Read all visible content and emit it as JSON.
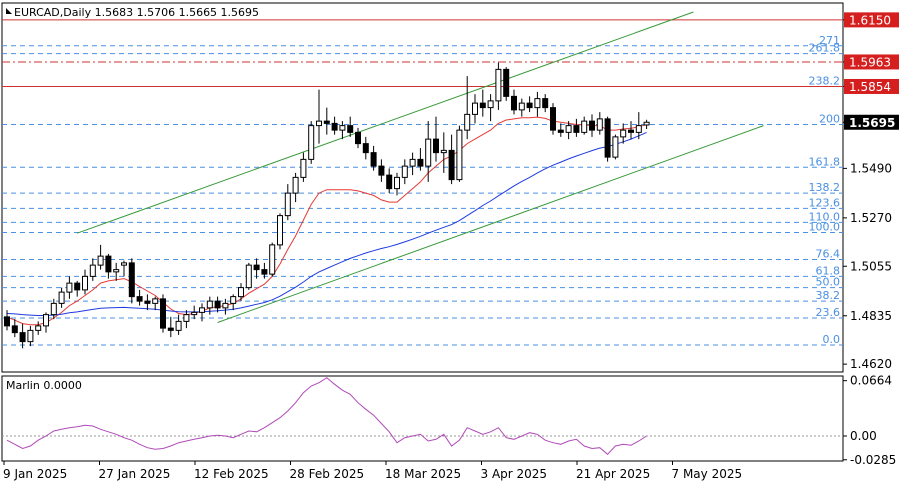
{
  "header": {
    "symbol": "EURCAD,Daily",
    "ohlc": "1.5683 1.5706 1.5665 1.5695"
  },
  "indicator_header": {
    "name": "Marlin",
    "value": "0.0000"
  },
  "colors": {
    "bull_candle": "#ffffff",
    "bear_candle": "#000000",
    "ma_red": "#e53935",
    "ma_blue": "#1e3ae0",
    "channel": "#3a9a3a",
    "fib": "#4a90e2",
    "resistance": "#d03030",
    "marlin": "#b04ab8",
    "price_tag_bg": "#d51f1f",
    "current_tag_bg": "#000000"
  },
  "chart_data": [
    {
      "type": "candlestick",
      "title": "EURCAD,Daily",
      "x_tick_labels": [
        "9 Jan 2025",
        "27 Jan 2025",
        "12 Feb 2025",
        "28 Feb 2025",
        "18 Mar 2025",
        "3 Apr 2025",
        "21 Apr 2025",
        "7 May 2025"
      ],
      "y_tick_labels": [
        "1.6150",
        "1.5963",
        "1.5854",
        "1.5695",
        "1.5490",
        "1.5270",
        "1.5055",
        "1.4835",
        "1.4620"
      ],
      "ylim": [
        1.4585,
        1.6225
      ],
      "candles": [
        {
          "o": 1.483,
          "h": 1.486,
          "l": 1.477,
          "c": 1.479
        },
        {
          "o": 1.479,
          "h": 1.482,
          "l": 1.474,
          "c": 1.476
        },
        {
          "o": 1.476,
          "h": 1.48,
          "l": 1.469,
          "c": 1.472
        },
        {
          "o": 1.472,
          "h": 1.479,
          "l": 1.47,
          "c": 1.477
        },
        {
          "o": 1.477,
          "h": 1.481,
          "l": 1.475,
          "c": 1.479
        },
        {
          "o": 1.479,
          "h": 1.485,
          "l": 1.476,
          "c": 1.484
        },
        {
          "o": 1.484,
          "h": 1.491,
          "l": 1.482,
          "c": 1.489
        },
        {
          "o": 1.489,
          "h": 1.496,
          "l": 1.487,
          "c": 1.494
        },
        {
          "o": 1.494,
          "h": 1.501,
          "l": 1.491,
          "c": 1.498
        },
        {
          "o": 1.498,
          "h": 1.499,
          "l": 1.492,
          "c": 1.495
        },
        {
          "o": 1.495,
          "h": 1.504,
          "l": 1.493,
          "c": 1.501
        },
        {
          "o": 1.501,
          "h": 1.509,
          "l": 1.499,
          "c": 1.506
        },
        {
          "o": 1.506,
          "h": 1.515,
          "l": 1.504,
          "c": 1.51
        },
        {
          "o": 1.51,
          "h": 1.511,
          "l": 1.5,
          "c": 1.503
        },
        {
          "o": 1.503,
          "h": 1.507,
          "l": 1.499,
          "c": 1.504
        },
        {
          "o": 1.506,
          "h": 1.508,
          "l": 1.501,
          "c": 1.507
        },
        {
          "o": 1.507,
          "h": 1.509,
          "l": 1.489,
          "c": 1.492
        },
        {
          "o": 1.492,
          "h": 1.495,
          "l": 1.488,
          "c": 1.49
        },
        {
          "o": 1.49,
          "h": 1.493,
          "l": 1.486,
          "c": 1.489
        },
        {
          "o": 1.489,
          "h": 1.492,
          "l": 1.486,
          "c": 1.491
        },
        {
          "o": 1.491,
          "h": 1.493,
          "l": 1.476,
          "c": 1.478
        },
        {
          "o": 1.478,
          "h": 1.483,
          "l": 1.474,
          "c": 1.477
        },
        {
          "o": 1.477,
          "h": 1.484,
          "l": 1.475,
          "c": 1.481
        },
        {
          "o": 1.481,
          "h": 1.486,
          "l": 1.478,
          "c": 1.484
        },
        {
          "o": 1.484,
          "h": 1.488,
          "l": 1.482,
          "c": 1.485
        },
        {
          "o": 1.485,
          "h": 1.489,
          "l": 1.481,
          "c": 1.487
        },
        {
          "o": 1.487,
          "h": 1.492,
          "l": 1.484,
          "c": 1.49
        },
        {
          "o": 1.49,
          "h": 1.492,
          "l": 1.485,
          "c": 1.487
        },
        {
          "o": 1.487,
          "h": 1.491,
          "l": 1.484,
          "c": 1.489
        },
        {
          "o": 1.489,
          "h": 1.493,
          "l": 1.486,
          "c": 1.492
        },
        {
          "o": 1.492,
          "h": 1.498,
          "l": 1.49,
          "c": 1.496
        },
        {
          "o": 1.496,
          "h": 1.507,
          "l": 1.495,
          "c": 1.506
        },
        {
          "o": 1.506,
          "h": 1.509,
          "l": 1.5,
          "c": 1.504
        },
        {
          "o": 1.504,
          "h": 1.507,
          "l": 1.5,
          "c": 1.502
        },
        {
          "o": 1.502,
          "h": 1.516,
          "l": 1.501,
          "c": 1.515
        },
        {
          "o": 1.515,
          "h": 1.529,
          "l": 1.513,
          "c": 1.528
        },
        {
          "o": 1.528,
          "h": 1.542,
          "l": 1.526,
          "c": 1.538
        },
        {
          "o": 1.538,
          "h": 1.547,
          "l": 1.534,
          "c": 1.545
        },
        {
          "o": 1.545,
          "h": 1.556,
          "l": 1.543,
          "c": 1.553
        },
        {
          "o": 1.553,
          "h": 1.57,
          "l": 1.551,
          "c": 1.568
        },
        {
          "o": 1.568,
          "h": 1.584,
          "l": 1.56,
          "c": 1.57
        },
        {
          "o": 1.57,
          "h": 1.576,
          "l": 1.564,
          "c": 1.569
        },
        {
          "o": 1.569,
          "h": 1.572,
          "l": 1.564,
          "c": 1.566
        },
        {
          "o": 1.566,
          "h": 1.57,
          "l": 1.562,
          "c": 1.568
        },
        {
          "o": 1.568,
          "h": 1.572,
          "l": 1.563,
          "c": 1.565
        },
        {
          "o": 1.565,
          "h": 1.567,
          "l": 1.558,
          "c": 1.56
        },
        {
          "o": 1.56,
          "h": 1.563,
          "l": 1.553,
          "c": 1.556
        },
        {
          "o": 1.556,
          "h": 1.559,
          "l": 1.548,
          "c": 1.55
        },
        {
          "o": 1.55,
          "h": 1.553,
          "l": 1.543,
          "c": 1.546
        },
        {
          "o": 1.546,
          "h": 1.549,
          "l": 1.538,
          "c": 1.54
        },
        {
          "o": 1.54,
          "h": 1.547,
          "l": 1.537,
          "c": 1.545
        },
        {
          "o": 1.545,
          "h": 1.553,
          "l": 1.542,
          "c": 1.55
        },
        {
          "o": 1.55,
          "h": 1.556,
          "l": 1.546,
          "c": 1.553
        },
        {
          "o": 1.553,
          "h": 1.558,
          "l": 1.548,
          "c": 1.55
        },
        {
          "o": 1.55,
          "h": 1.57,
          "l": 1.543,
          "c": 1.562
        },
        {
          "o": 1.562,
          "h": 1.572,
          "l": 1.552,
          "c": 1.556
        },
        {
          "o": 1.556,
          "h": 1.565,
          "l": 1.547,
          "c": 1.557
        },
        {
          "o": 1.557,
          "h": 1.564,
          "l": 1.542,
          "c": 1.544
        },
        {
          "o": 1.544,
          "h": 1.568,
          "l": 1.543,
          "c": 1.566
        },
        {
          "o": 1.566,
          "h": 1.59,
          "l": 1.562,
          "c": 1.573
        },
        {
          "o": 1.573,
          "h": 1.582,
          "l": 1.569,
          "c": 1.578
        },
        {
          "o": 1.578,
          "h": 1.584,
          "l": 1.572,
          "c": 1.576
        },
        {
          "o": 1.576,
          "h": 1.582,
          "l": 1.57,
          "c": 1.579
        },
        {
          "o": 1.579,
          "h": 1.596,
          "l": 1.575,
          "c": 1.593
        },
        {
          "o": 1.593,
          "h": 1.594,
          "l": 1.579,
          "c": 1.581
        },
        {
          "o": 1.581,
          "h": 1.584,
          "l": 1.573,
          "c": 1.575
        },
        {
          "o": 1.575,
          "h": 1.58,
          "l": 1.572,
          "c": 1.578
        },
        {
          "o": 1.578,
          "h": 1.581,
          "l": 1.574,
          "c": 1.576
        },
        {
          "o": 1.576,
          "h": 1.583,
          "l": 1.572,
          "c": 1.58
        },
        {
          "o": 1.58,
          "h": 1.582,
          "l": 1.574,
          "c": 1.576
        },
        {
          "o": 1.576,
          "h": 1.578,
          "l": 1.564,
          "c": 1.566
        },
        {
          "o": 1.566,
          "h": 1.569,
          "l": 1.563,
          "c": 1.565
        },
        {
          "o": 1.565,
          "h": 1.57,
          "l": 1.562,
          "c": 1.568
        },
        {
          "o": 1.568,
          "h": 1.571,
          "l": 1.563,
          "c": 1.565
        },
        {
          "o": 1.565,
          "h": 1.572,
          "l": 1.564,
          "c": 1.57
        },
        {
          "o": 1.57,
          "h": 1.573,
          "l": 1.563,
          "c": 1.566
        },
        {
          "o": 1.566,
          "h": 1.574,
          "l": 1.564,
          "c": 1.571
        },
        {
          "o": 1.571,
          "h": 1.572,
          "l": 1.552,
          "c": 1.554
        },
        {
          "o": 1.554,
          "h": 1.564,
          "l": 1.553,
          "c": 1.563
        },
        {
          "o": 1.563,
          "h": 1.569,
          "l": 1.56,
          "c": 1.566
        },
        {
          "o": 1.566,
          "h": 1.57,
          "l": 1.562,
          "c": 1.565
        },
        {
          "o": 1.565,
          "h": 1.574,
          "l": 1.562,
          "c": 1.568
        },
        {
          "o": 1.5683,
          "h": 1.5706,
          "l": 1.5665,
          "c": 1.5695
        }
      ],
      "moving_averages": [
        {
          "color": "red",
          "values": [
            1.483,
            1.4815,
            1.48,
            1.4795,
            1.4795,
            1.4805,
            1.4825,
            1.485,
            1.488,
            1.49,
            1.4925,
            1.495,
            1.498,
            1.499,
            1.4995,
            1.5,
            1.4985,
            1.4965,
            1.4945,
            1.4925,
            1.4895,
            1.4865,
            1.4845,
            1.484,
            1.4845,
            1.4855,
            1.487,
            1.4875,
            1.488,
            1.489,
            1.491,
            1.4935,
            1.4955,
            1.4975,
            1.501,
            1.5065,
            1.513,
            1.519,
            1.526,
            1.533,
            1.538,
            1.5395,
            1.5395,
            1.5395,
            1.5395,
            1.539,
            1.538,
            1.537,
            1.535,
            1.534,
            1.534,
            1.537,
            1.54,
            1.543,
            1.547,
            1.55,
            1.553,
            1.5545,
            1.557,
            1.56,
            1.562,
            1.564,
            1.566,
            1.569,
            1.5705,
            1.571,
            1.5715,
            1.5715,
            1.5718,
            1.5712,
            1.57,
            1.5695,
            1.569,
            1.5685,
            1.5683,
            1.568,
            1.568,
            1.566,
            1.566,
            1.5665,
            1.5668,
            1.5675,
            1.5685
          ]
        },
        {
          "color": "blue",
          "values": [
            1.4845,
            1.4843,
            1.484,
            1.4838,
            1.4836,
            1.4836,
            1.4838,
            1.4842,
            1.4848,
            1.4852,
            1.4858,
            1.4863,
            1.4868,
            1.487,
            1.4871,
            1.4872,
            1.487,
            1.4868,
            1.4866,
            1.4864,
            1.486,
            1.4856,
            1.4853,
            1.4852,
            1.4852,
            1.4853,
            1.4855,
            1.4857,
            1.486,
            1.4864,
            1.487,
            1.4878,
            1.4886,
            1.4894,
            1.4906,
            1.4922,
            1.4942,
            1.4962,
            1.4985,
            1.501,
            1.503,
            1.5045,
            1.506,
            1.5075,
            1.509,
            1.5102,
            1.5114,
            1.5124,
            1.5134,
            1.5142,
            1.5152,
            1.5163,
            1.5175,
            1.5188,
            1.5202,
            1.5215,
            1.5228,
            1.524,
            1.5258,
            1.528,
            1.5302,
            1.5325,
            1.5345,
            1.5368,
            1.539,
            1.5412,
            1.5432,
            1.545,
            1.547,
            1.5488,
            1.5504,
            1.5518,
            1.5532,
            1.5545,
            1.5557,
            1.5569,
            1.558,
            1.5587,
            1.5597,
            1.5608,
            1.562,
            1.5635,
            1.565
          ]
        }
      ],
      "fibonacci_levels": [
        {
          "label": "271",
          "price": 1.6035
        },
        {
          "label": "261.8",
          "price": 1.6
        },
        {
          "label": "238.2",
          "price": 1.5854
        },
        {
          "label": "200",
          "price": 1.5685
        },
        {
          "label": "161.8",
          "price": 1.5495
        },
        {
          "label": "138.2",
          "price": 1.538
        },
        {
          "label": "123.6",
          "price": 1.5312
        },
        {
          "label": "110.0",
          "price": 1.525
        },
        {
          "label": "100.0",
          "price": 1.5205
        },
        {
          "label": "76.4",
          "price": 1.5085
        },
        {
          "label": "61.8",
          "price": 1.501
        },
        {
          "label": "50.0",
          "price": 1.496
        },
        {
          "label": "38.2",
          "price": 1.49
        },
        {
          "label": "23.6",
          "price": 1.4825
        },
        {
          "label": "0.0",
          "price": 1.4705
        }
      ],
      "horizontal_levels": [
        {
          "label": "1.6150",
          "price": 1.615,
          "style": "solid"
        },
        {
          "label": "1.5963",
          "price": 1.5963,
          "style": "dashdot"
        },
        {
          "label": "1.5854",
          "price": 1.5854,
          "style": "solid"
        }
      ],
      "current_price_label": "1.5695",
      "current_price": 1.5695,
      "channel_lines": [
        {
          "from": {
            "bar": 9,
            "price": 1.5202
          },
          "to": {
            "bar": 88,
            "price": 1.6185
          }
        },
        {
          "from": {
            "bar": 27,
            "price": 1.4805
          },
          "to": {
            "bar": 97,
            "price": 1.568
          }
        }
      ]
    },
    {
      "type": "line",
      "title": "Marlin 0.0000",
      "y_tick_labels": [
        "0.0664",
        "0.00",
        "-0.0285"
      ],
      "ylim": [
        -0.03,
        0.072
      ],
      "zero_line": 0.0,
      "values": [
        -0.005,
        -0.01,
        -0.015,
        -0.012,
        -0.005,
        0.0,
        0.006,
        0.008,
        0.01,
        0.011,
        0.013,
        0.012,
        0.008,
        0.005,
        0.002,
        -0.002,
        -0.005,
        -0.01,
        -0.014,
        -0.016,
        -0.015,
        -0.012,
        -0.008,
        -0.006,
        -0.004,
        -0.002,
        0.0,
        0.001,
        0.0,
        -0.002,
        0.002,
        0.006,
        0.005,
        0.01,
        0.016,
        0.022,
        0.03,
        0.04,
        0.052,
        0.06,
        0.064,
        0.07,
        0.062,
        0.055,
        0.05,
        0.04,
        0.032,
        0.025,
        0.015,
        0.005,
        -0.008,
        -0.002,
        0.0,
        0.002,
        -0.006,
        -0.004,
        0.002,
        -0.012,
        -0.005,
        0.01,
        0.006,
        0.002,
        0.005,
        0.01,
        -0.002,
        -0.004,
        0.0,
        0.004,
        0.002,
        -0.005,
        -0.008,
        -0.01,
        -0.006,
        -0.004,
        -0.012,
        -0.015,
        -0.014,
        -0.022,
        -0.012,
        -0.01,
        -0.011,
        -0.006,
        0.0
      ]
    }
  ]
}
